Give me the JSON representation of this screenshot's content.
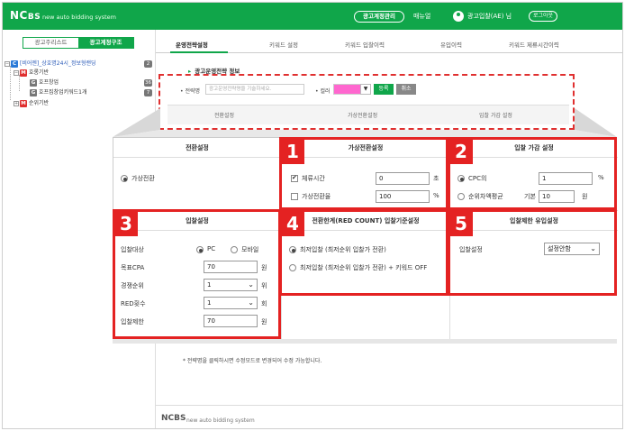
{
  "header": {
    "logo": "NC",
    "logo_suffix": "BS",
    "logo_sub": "new auto bidding system",
    "ads_mgmt_button": "광고계정관리",
    "manual_menu": "매뉴얼",
    "user_name": "광고입찰(AE) 님",
    "logout_button": "로그아웃"
  },
  "sidebar": {
    "tab_list": "광고주리스트",
    "tab_struct": "광고계정구조",
    "tree": [
      {
        "badge": "C",
        "label": "[비어젠]_상호명24시_정보형랜딩",
        "count": "2"
      },
      {
        "badge": "M",
        "label": "호롱기반",
        "count": ""
      },
      {
        "badge": "G",
        "label": "호프창업",
        "count": "36"
      },
      {
        "badge": "G",
        "label": "호프집창업키워드1개",
        "count": "7"
      },
      {
        "badge": "M",
        "label": "순위기반",
        "count": ""
      }
    ]
  },
  "main": {
    "tabs": [
      "운영전략설정",
      "키워드 설정",
      "키워드 입찰이력",
      "유입이력",
      "키워드 제류시간이력"
    ],
    "section_title": "광고운영전략 정보",
    "filter": {
      "strategy_label": "전략명",
      "strategy_placeholder": "광고운영전략명을 기술하세요.",
      "color_label": "컬러",
      "color_value": "#ff67cf",
      "register_button": "등록",
      "cancel_button": "취소"
    },
    "bg_headers": [
      "전환설정",
      "가상전환설정",
      "입찰 가감 설정"
    ],
    "note": "* 전략명을 클릭하시면 수정모드로 변경되어 수정 가능합니다."
  },
  "panel": {
    "conversion": {
      "title": "전환설정",
      "virtual_conversion": "가상전환"
    },
    "virtual": {
      "tag": "1",
      "title": "가상전환설정",
      "dwell_label": "체류시간",
      "dwell_value": "0",
      "dwell_unit": "초",
      "rate_label": "가상전환율",
      "rate_value": "100",
      "rate_unit": "%"
    },
    "bid_adjust": {
      "tag": "2",
      "title": "입찰 가감 설정",
      "cpc_label": "CPC의",
      "cpc_value": "1",
      "cpc_unit": "%",
      "rank_label": "순위차액평균",
      "base_label": "기본",
      "base_value": "10",
      "base_unit": "원"
    },
    "bid_setting": {
      "tag": "3",
      "title": "입찰설정",
      "target_label": "입찰대상",
      "target_pc": "PC",
      "target_mobile": "모바일",
      "cpa_label": "목표CPA",
      "cpa_value": "70",
      "cpa_unit": "원",
      "rank_label": "경쟁순위",
      "rank_value": "1",
      "rank_unit": "위",
      "red_label": "RED횟수",
      "red_value": "1",
      "red_unit": "회",
      "limit_label": "입찰제한",
      "limit_value": "70",
      "limit_unit": "원"
    },
    "red_count": {
      "tag": "4",
      "title": "전환한계(RED COUNT) 입찰기준설정",
      "option1": "최저입찰 (최저순위 입찰가 전환)",
      "option2": "최저입찰 (최저순위 입찰가 전환) + 키워드 OFF"
    },
    "inflow_limit": {
      "tag": "5",
      "title": "입찰제한 유입설정",
      "label": "입찰설정",
      "select_value": "설정안함"
    }
  },
  "footer": {
    "logo": "NCBS",
    "sub": "new auto bidding system"
  }
}
